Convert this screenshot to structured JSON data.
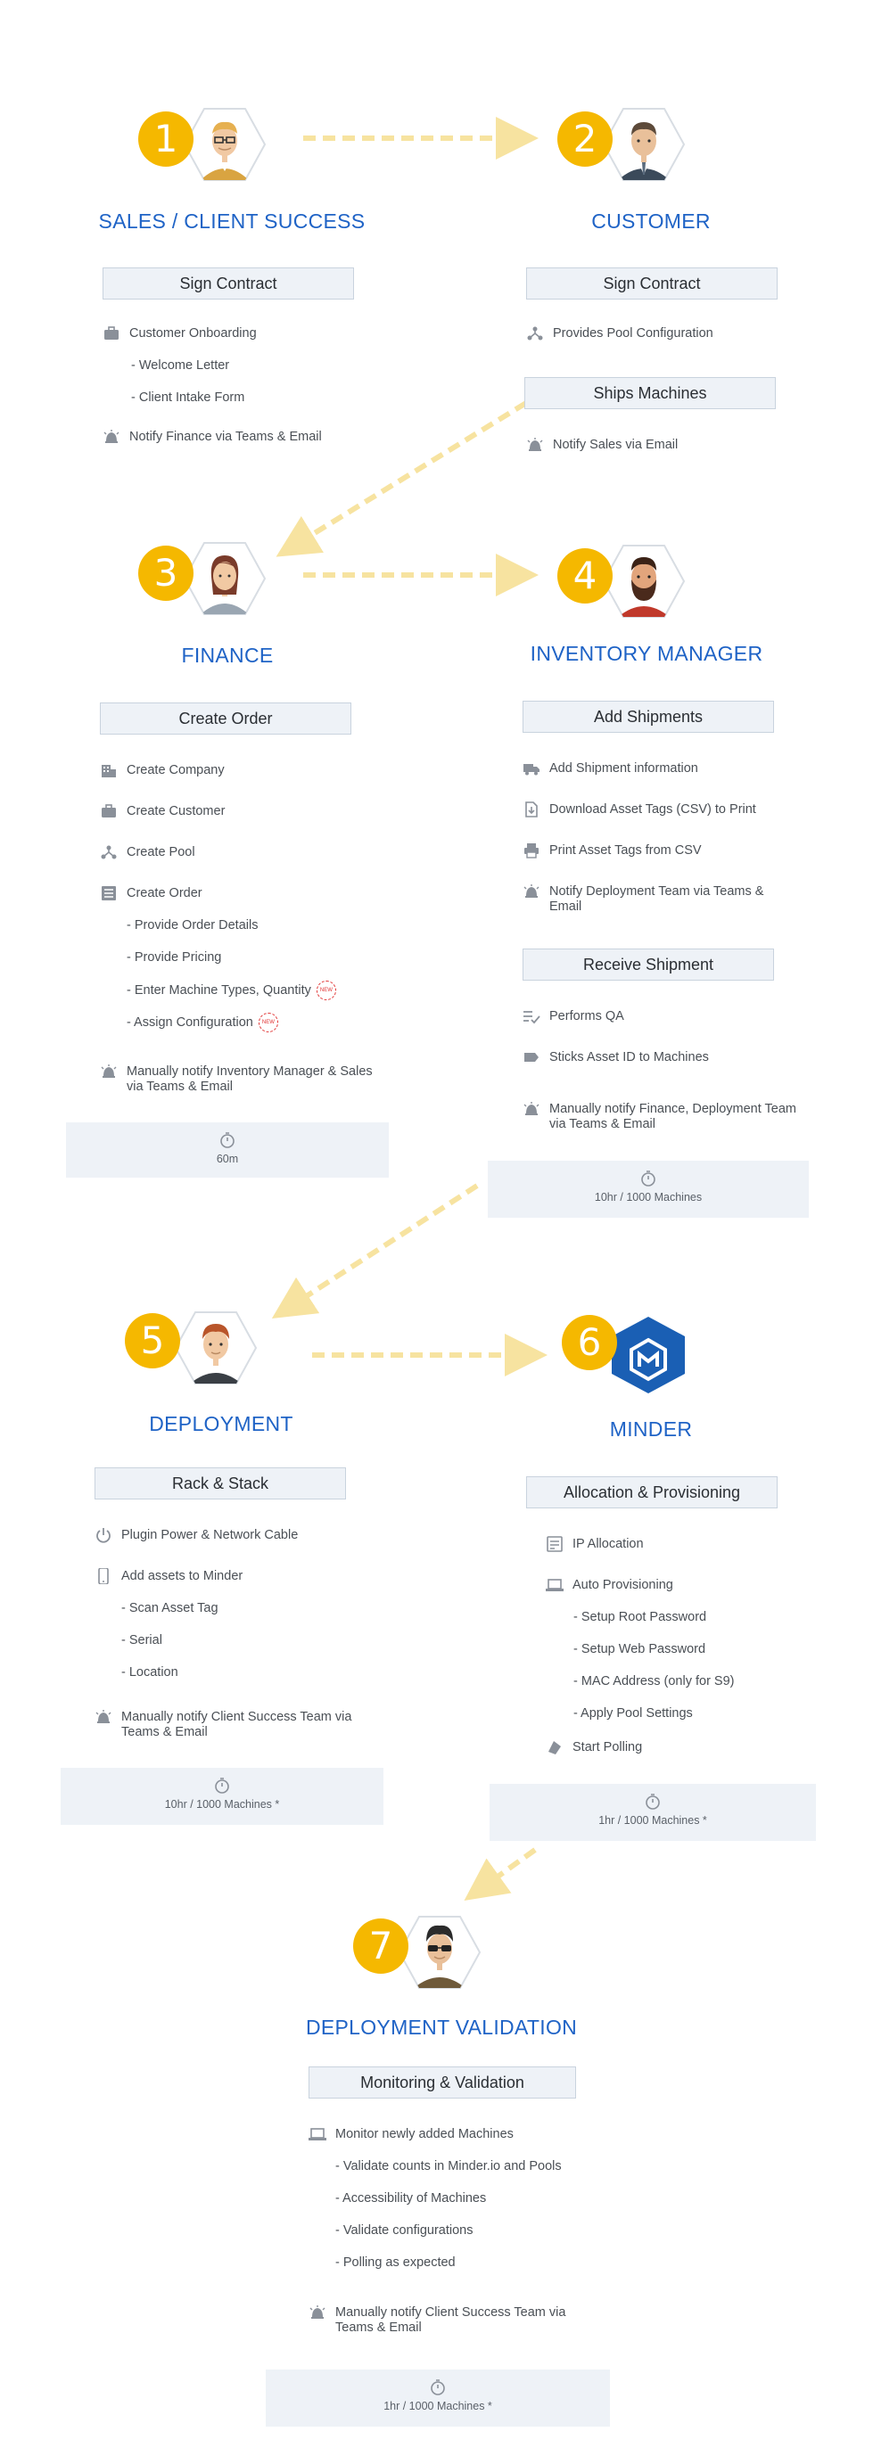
{
  "steps": [
    {
      "num": "1",
      "title": "SALES / CLIENT SUCCESS"
    },
    {
      "num": "2",
      "title": "CUSTOMER"
    },
    {
      "num": "3",
      "title": "FINANCE"
    },
    {
      "num": "4",
      "title": "INVENTORY MANAGER"
    },
    {
      "num": "5",
      "title": "DEPLOYMENT"
    },
    {
      "num": "6",
      "title": "MINDER"
    },
    {
      "num": "7",
      "title": "DEPLOYMENT VALIDATION"
    }
  ],
  "sales": {
    "box": "Sign Contract",
    "items": [
      "Customer Onboarding",
      "- Welcome Letter",
      "- Client Intake Form",
      "Notify Finance via Teams & Email"
    ]
  },
  "customer": {
    "box1": "Sign Contract",
    "item1": "Provides Pool Configuration",
    "box2": "Ships Machines",
    "item2": "Notify Sales via Email"
  },
  "finance": {
    "box": "Create Order",
    "items": [
      "Create Company",
      "Create Customer",
      "Create Pool",
      "Create Order",
      "- Provide Order Details",
      "- Provide Pricing",
      "- Enter Machine Types, Quantity",
      "- Assign Configuration",
      "Manually notify Inventory Manager & Sales via Teams & Email"
    ],
    "new_tag": "NEW",
    "time": "60m"
  },
  "inventory": {
    "box1": "Add Shipments",
    "items1": [
      "Add Shipment information",
      "Download Asset Tags (CSV) to Print",
      "Print Asset Tags from CSV",
      "Notify Deployment Team via Teams & Email"
    ],
    "box2": "Receive Shipment",
    "items2": [
      "Performs QA",
      "Sticks Asset ID to Machines",
      "Manually notify Finance, Deployment Team via Teams & Email"
    ],
    "time": "10hr / 1000 Machines"
  },
  "deployment": {
    "box": "Rack & Stack",
    "items": [
      "Plugin Power & Network Cable",
      "Add assets to Minder",
      "- Scan Asset Tag",
      "- Serial",
      "- Location",
      "Manually notify Client Success Team via Teams & Email"
    ],
    "time": "10hr / 1000 Machines *"
  },
  "minder": {
    "box": "Allocation & Provisioning",
    "items": [
      "IP Allocation",
      "Auto Provisioning",
      "- Setup Root Password",
      "- Setup Web Password",
      "- MAC Address (only for S9)",
      "- Apply Pool Settings",
      "Start Polling"
    ],
    "time": "1hr / 1000 Machines *"
  },
  "validation": {
    "box": "Monitoring & Validation",
    "items": [
      "Monitor newly added Machines",
      "- Validate counts in Minder.io and Pools",
      "- Accessibility of Machines",
      "- Validate configurations",
      "- Polling as expected",
      "Manually notify Client Success Team via Teams & Email"
    ],
    "time": "1hr / 1000 Machines *"
  },
  "icons": {
    "accent": "#f5b800",
    "title_color": "#1f63c6",
    "arrow_color": "#f7e3a0",
    "minder_blue": "#1a5fb4"
  }
}
